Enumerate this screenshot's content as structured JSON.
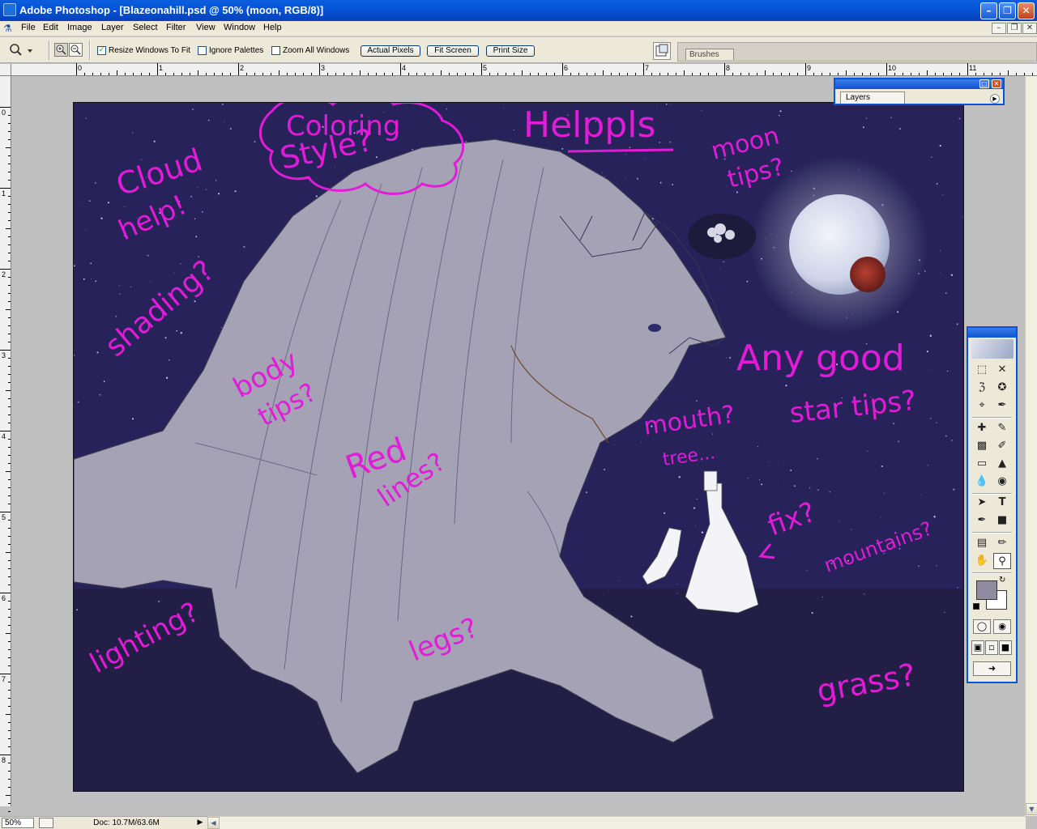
{
  "window": {
    "title": "Adobe Photoshop - [Blazeonahill.psd @ 50% (moon, RGB/8)]",
    "minimize": "–",
    "restore": "❐",
    "close": "✕"
  },
  "menu": {
    "items": [
      "File",
      "Edit",
      "Image",
      "Layer",
      "Select",
      "Filter",
      "View",
      "Window",
      "Help"
    ]
  },
  "options": {
    "resize_windows": "Resize Windows To Fit",
    "ignore_palettes": "Ignore Palettes",
    "zoom_all": "Zoom All Windows",
    "actual_pixels": "Actual Pixels",
    "fit_screen": "Fit Screen",
    "print_size": "Print Size",
    "resize_checked": true,
    "ignore_checked": false,
    "zoom_all_checked": false
  },
  "palette_well": {
    "brushes_tab": "Brushes"
  },
  "layers_palette": {
    "tab": "Layers"
  },
  "rulers": {
    "h_labels": [
      "0",
      "1",
      "2",
      "3",
      "4",
      "5",
      "6",
      "7",
      "8",
      "9",
      "10",
      "11"
    ],
    "v_labels": [
      "0",
      "1",
      "2",
      "3",
      "4",
      "5",
      "6",
      "7",
      "8"
    ]
  },
  "status": {
    "zoom": "50%",
    "doc": "Doc: 10.7M/63.6M",
    "menu_arrow": "▶"
  },
  "canvas_annotations": {
    "coloring": "Coloring",
    "style": "Style?",
    "helppls": "Helppls",
    "moon_tips": "moon",
    "moon_tips2": "tips?",
    "cloud": "Cloud",
    "help": "help!",
    "shading": "shading?",
    "body": "body",
    "tips": "tips?",
    "anygood": "Any good",
    "star_tips": "star tips?",
    "mouth": "mouth?",
    "tree": "tree...",
    "red": "Red",
    "lines": "lines?",
    "fix": "fix?",
    "mountains": "mountains?",
    "lighting": "lighting?",
    "legs": "legs?",
    "grass": "grass?"
  },
  "colors": {
    "canvas_bg": "#23204a",
    "annotation": "#e21bd9",
    "creature": "#a6a2b5",
    "moon": "#dfe2ee",
    "foreground": "#8f8ba0",
    "background": "#ffffff"
  },
  "toolbox": {
    "tools": [
      "marquee-icon",
      "move-icon",
      "lasso-icon",
      "magic-wand-icon",
      "crop-icon",
      "slice-icon",
      "healing-icon",
      "brush-icon",
      "stamp-icon",
      "history-brush-icon",
      "eraser-icon",
      "bucket-icon",
      "blur-icon",
      "dodge-icon",
      "path-select-icon",
      "type-icon",
      "pen-icon",
      "shape-icon",
      "notes-icon",
      "eyedropper-icon",
      "hand-icon",
      "zoom-icon"
    ]
  }
}
